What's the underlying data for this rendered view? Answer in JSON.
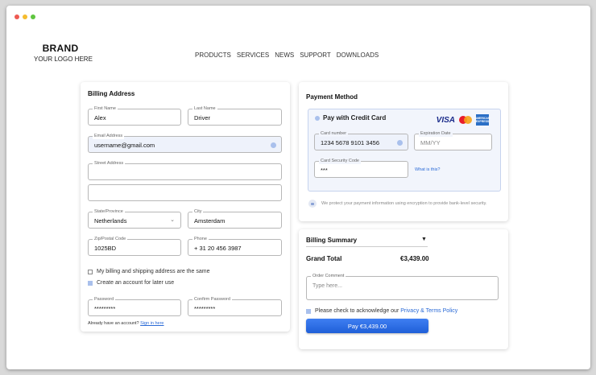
{
  "window": {
    "dots": [
      "#ee5a52",
      "#f5bc2f",
      "#5fc53f"
    ]
  },
  "brand": {
    "name": "BRAND",
    "tagline": "YOUR LOGO HERE"
  },
  "nav": [
    "PRODUCTS",
    "SERVICES",
    "NEWS",
    "SUPPORT",
    "DOWNLOADS"
  ],
  "billing": {
    "title": "Billing Address",
    "first_name": {
      "label": "First Name",
      "value": "Alex"
    },
    "last_name": {
      "label": "Last Name",
      "value": "Driver"
    },
    "email": {
      "label": "Email Address",
      "value": "username@gmail.com"
    },
    "street": {
      "label": "Street Address",
      "value": ""
    },
    "street2": {
      "value": ""
    },
    "state": {
      "label": "State/Province",
      "value": "Netherlands"
    },
    "city": {
      "label": "City",
      "value": "Amsterdam"
    },
    "zip": {
      "label": "Zip/Postal Code",
      "value": "1025BD"
    },
    "phone": {
      "label": "Phone",
      "value": "+ 31 20 456 3987"
    },
    "same_address": {
      "label": "My billing and shipping address are the same",
      "checked": false
    },
    "create_account": {
      "label": "Create an account for later use",
      "checked": true
    },
    "password": {
      "label": "Password",
      "value": "*********"
    },
    "confirm_password": {
      "label": "Confirm Password",
      "value": "*********"
    },
    "signin_prompt": "Already have an account?",
    "signin_link": "Sign in here"
  },
  "payment": {
    "title": "Payment Method",
    "option": "Pay with Credit Card",
    "card_logos": {
      "visa": "VISA",
      "mastercard": "mastercard",
      "amex": "AMERICAN EXPRESS"
    },
    "card_number": {
      "label": "Card number",
      "value": "1234 5678 9101 3456"
    },
    "expiration": {
      "label": "Expiration Date",
      "placeholder": "MM/YY"
    },
    "security": {
      "label": "Card Security Code",
      "value": "***"
    },
    "what_is_this": "What is this?",
    "security_note": "We protect your payment information using encryption to provide bank-level security."
  },
  "summary": {
    "title": "Billing Summary",
    "grand_total_label": "Grand Total",
    "grand_total_value": "€3,439.00",
    "comment_label": "Order Comment",
    "comment_placeholder": "Type here...",
    "acknowledge_prefix": "Please check to acknowledge our",
    "acknowledge_link": "Privacy & Terms Policy",
    "pay_button": "Pay €3,439.00"
  }
}
